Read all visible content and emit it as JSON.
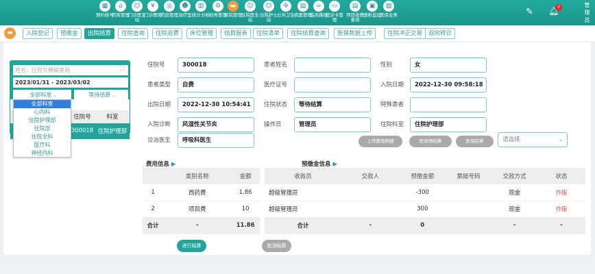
{
  "topnav": {
    "items": [
      {
        "label": "预约挂号",
        "icon": "calendar-icon"
      },
      {
        "label": "药库管理",
        "icon": "warehouse-icon"
      },
      {
        "label": "门诊医生站",
        "icon": "doctor-icon"
      },
      {
        "label": "门诊费用",
        "icon": "yen-icon"
      },
      {
        "label": "药房管理",
        "icon": "pill-icon"
      },
      {
        "label": "治疗室",
        "icon": "nurse-icon"
      },
      {
        "label": "统计分析",
        "icon": "chart-icon"
      },
      {
        "label": "财务管理",
        "icon": "gear-icon"
      },
      {
        "label": "住院管理",
        "icon": "bed-icon",
        "active": true
      },
      {
        "label": "住院医生站",
        "icon": "doctor-desk-icon"
      },
      {
        "label": "住院护士站",
        "icon": "nurse-desk-icon"
      },
      {
        "label": "公共卫生",
        "icon": "health-icon"
      },
      {
        "label": "病案管理",
        "icon": "record-icon"
      },
      {
        "label": "临床路径",
        "icon": "path-icon"
      },
      {
        "label": "就诊卡管理",
        "icon": "card-icon"
      },
      {
        "label": "项目收费查询",
        "icon": "fee-query-icon"
      },
      {
        "label": "透析监控",
        "icon": "dialysis-icon"
      },
      {
        "label": "医保业务",
        "icon": "insurance-icon"
      }
    ],
    "notification_count": "0",
    "user": "管理员"
  },
  "tabs": [
    "入院登记",
    "预缴金",
    "出院结算",
    "住院查询",
    "住院退费",
    "床位管理",
    "结算报表",
    "住院清单",
    "住院结算查询",
    "医保数据上传",
    "住院冲正交易",
    "双向转诊"
  ],
  "active_tab": "出院结算",
  "left_panel": {
    "search_placeholder": "姓名、住院号模糊查询",
    "date_range": "2023/01/31 - 2023/03/02",
    "dept_select": "全部科室",
    "status_select": "等待结算",
    "dept_options": [
      "全部科室",
      "心内科",
      "住院护理部",
      "住院部",
      "住院全科",
      "医疗科",
      "神经内科"
    ],
    "table": {
      "headers": [
        "住院号",
        "科室"
      ],
      "rows": [
        [
          "300018",
          "住院护理部"
        ]
      ]
    }
  },
  "form": {
    "inpatient_no_label": "住院号",
    "inpatient_no": "300018",
    "patient_name_label": "患者姓名",
    "patient_name": "",
    "gender_label": "性别",
    "gender": "女",
    "patient_type_label": "患者类型",
    "patient_type": "自费",
    "medical_card_label": "医疗证号",
    "medical_card": "",
    "admit_date_label": "入院日期",
    "admit_date": "2022-12-30 09:58:18",
    "discharge_date_label": "出院日期",
    "discharge_date": "2022-12-30 10:54:41",
    "status_label": "住院状态",
    "status": "等待结算",
    "special_label": "特殊患者",
    "special": "",
    "diagnosis_label": "入院诊断",
    "diagnosis": "风湿性关节炎",
    "operator_label": "操作员",
    "operator": "管理员",
    "ward_label": "住院科室",
    "ward": "住院护理部",
    "doctor_label": "诊治医生",
    "doctor": "呼吸科医生"
  },
  "actions": {
    "upload": "上传费用明细",
    "pre_settle": "医保预结算",
    "settle_ins": "医保结算",
    "select_placeholder": "请选择",
    "settle": "进行结算",
    "cancel": "取消结算"
  },
  "fee_info": {
    "title": "费用信息",
    "headers": [
      "",
      "类别名称",
      "金额"
    ],
    "rows": [
      [
        "1",
        "西药费",
        "1.86"
      ],
      [
        "2",
        "项目费",
        "10"
      ]
    ],
    "total": [
      "合计",
      "-",
      "11.86"
    ]
  },
  "deposit_info": {
    "title": "预缴金信息",
    "headers": [
      "收款员",
      "交款人",
      "预缴金额",
      "票据号码",
      "交款方式",
      "状态"
    ],
    "rows": [
      [
        "超级管理员",
        "",
        "-300",
        "",
        "现金",
        "作废"
      ],
      [
        "超级管理员",
        "",
        "300",
        "",
        "现金",
        "作废"
      ]
    ],
    "total": [
      "合计",
      "-",
      "0",
      "",
      "-",
      "-"
    ]
  },
  "colors": {
    "primary": "#1fa59a",
    "active_module": "#f39c3c",
    "void": "#dd5555"
  }
}
